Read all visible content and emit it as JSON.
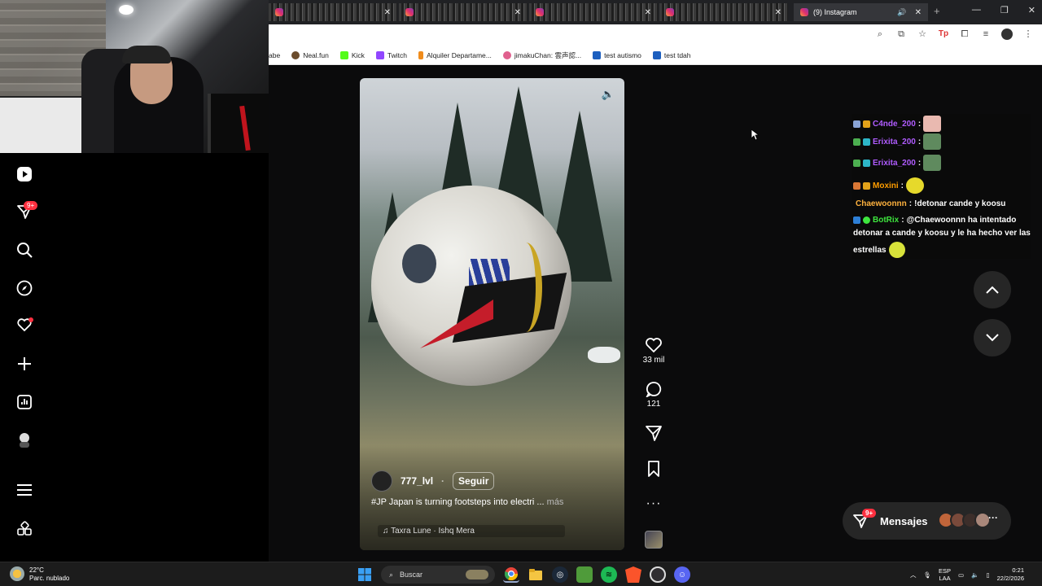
{
  "browser": {
    "tabs": [
      {
        "label": ""
      },
      {
        "label": ""
      },
      {
        "label": ""
      },
      {
        "label": ""
      },
      {
        "label": "(9) Instagram",
        "active": true
      }
    ],
    "bookmarks": [
      {
        "label": "abe",
        "color": "#ffffff"
      },
      {
        "label": "Neal.fun",
        "color": "#6b4c2c"
      },
      {
        "label": "Kick",
        "color": "#53fc18"
      },
      {
        "label": "Twitch",
        "color": "#9146ff"
      },
      {
        "label": "Alquiler Departame...",
        "color": "#f08c1c"
      },
      {
        "label": "jimakuChan: 雲声認...",
        "color": "#e0608e"
      },
      {
        "label": "test autismo",
        "color": "#1d5fbf"
      },
      {
        "label": "test tdah",
        "color": "#1d5fbf"
      }
    ]
  },
  "reel": {
    "author": "777_lvl",
    "follow_label": "Seguir",
    "caption": "#JP Japan is turning footsteps into electri ...",
    "more_label": "más",
    "music": "Taxra Lune · Ishq Mera"
  },
  "actions": {
    "likes": "33 mil",
    "comments": "121"
  },
  "chat": {
    "lines": [
      {
        "user": "C4nde_200",
        "color": "#b05cff",
        "text": ""
      },
      {
        "user": "Erixita_200",
        "color": "#b05cff",
        "text": ""
      },
      {
        "user": "Erixita_200",
        "color": "#b05cff",
        "text": ""
      },
      {
        "user": "Moxini",
        "color": "#ff9d00",
        "text": ""
      },
      {
        "user": "Chaewoonnn",
        "color": "#ffb23e",
        "text": "!detonar cande y koosu"
      },
      {
        "user": "BotRix",
        "color": "#3ee63e",
        "text": "@Chaewoonnn ha intentado"
      },
      {
        "user": "",
        "color": "#ffffff",
        "text": "detonar a cande y koosu y le ha hecho ver las"
      },
      {
        "user": "",
        "color": "#ffffff",
        "text": "estrellas"
      }
    ]
  },
  "sidebar": {
    "notif_badge": "9+"
  },
  "messages": {
    "label": "Mensajes",
    "badge": "9+"
  },
  "taskbar": {
    "temperature": "22°C",
    "weather": "Parc. nublado",
    "search": "Buscar",
    "lang1": "ESP",
    "lang2": "LAA",
    "time": "0:21",
    "date": "22/2/2026"
  },
  "colors": {
    "badge": "#ff3040",
    "page_bg": "#0b0b0c"
  }
}
